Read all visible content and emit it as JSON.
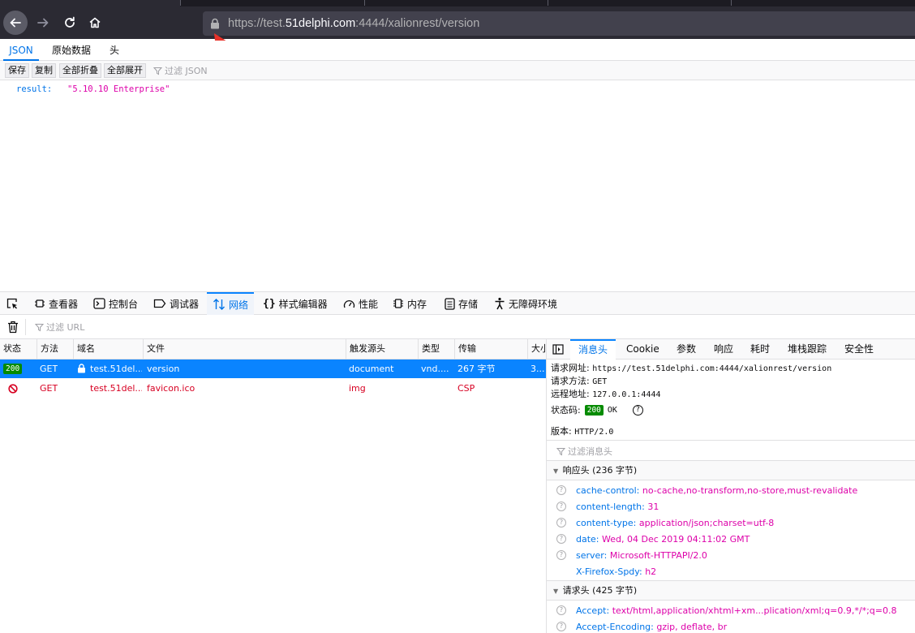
{
  "browser": {
    "url_scheme": "https://test.",
    "url_domain": "51delphi.com",
    "url_rest": ":4444/xalionrest/version"
  },
  "json_viewer": {
    "tabs": [
      "JSON",
      "原始数据",
      "头"
    ],
    "buttons": [
      "保存",
      "复制",
      "全部折叠",
      "全部展开"
    ],
    "filter_placeholder": "过滤 JSON",
    "key": "result:",
    "value": "\"5.10.10 Enterprise\""
  },
  "devtools": {
    "tabs": [
      "查看器",
      "控制台",
      "调试器",
      "网络",
      "样式编辑器",
      "性能",
      "内存",
      "存储",
      "无障碍环境"
    ],
    "url_filter_placeholder": "过滤 URL",
    "columns": [
      "状态",
      "方法",
      "域名",
      "文件",
      "触发源头",
      "类型",
      "传输",
      "大小"
    ],
    "requests": [
      {
        "status": "200",
        "method": "GET",
        "domain": "test.51del...",
        "file": "version",
        "cause": "document",
        "type": "vnd....",
        "transfer": "267 字节",
        "size": "3..."
      },
      {
        "status": "",
        "method": "GET",
        "domain": "test.51del...",
        "file": "favicon.ico",
        "cause": "img",
        "type": "",
        "transfer": "CSP",
        "size": ""
      }
    ],
    "side_tabs": [
      "消息头",
      "Cookie",
      "参数",
      "响应",
      "耗时",
      "堆栈跟踪",
      "安全性"
    ],
    "summary": {
      "request_url_label": "请求网址:",
      "request_url": "https://test.51delphi.com:4444/xalionrest/version",
      "method_label": "请求方法:",
      "method": "GET",
      "remote_label": "远程地址:",
      "remote": "127.0.0.1:4444",
      "status_label": "状态码:",
      "status_code": "200",
      "status_text": "OK",
      "version_label": "版本:",
      "version": "HTTP/2.0"
    },
    "headers_filter_placeholder": "过滤消息头",
    "response_section": "响应头 (236 字节)",
    "response_headers": [
      {
        "name": "cache-control:",
        "value": "no-cache,no-transform,no-store,must-revalidate"
      },
      {
        "name": "content-length:",
        "value": "31"
      },
      {
        "name": "content-type:",
        "value": "application/json;charset=utf-8"
      },
      {
        "name": "date:",
        "value": "Wed, 04 Dec 2019 04:11:02 GMT"
      },
      {
        "name": "server:",
        "value": "Microsoft-HTTPAPI/2.0"
      },
      {
        "name": "X-Firefox-Spdy:",
        "value": "h2"
      }
    ],
    "request_section": "请求头 (425 字节)",
    "request_headers": [
      {
        "name": "Accept:",
        "value": "text/html,application/xhtml+xm...plication/xml;q=0.9,*/*;q=0.8"
      },
      {
        "name": "Accept-Encoding:",
        "value": "gzip, deflate, br"
      }
    ]
  },
  "colors": {
    "accent": "#0074e8",
    "selected_row": "#0a84ff",
    "status_ok": "#058b00",
    "error_red": "#d70022",
    "header_value": "#dd00a9"
  }
}
